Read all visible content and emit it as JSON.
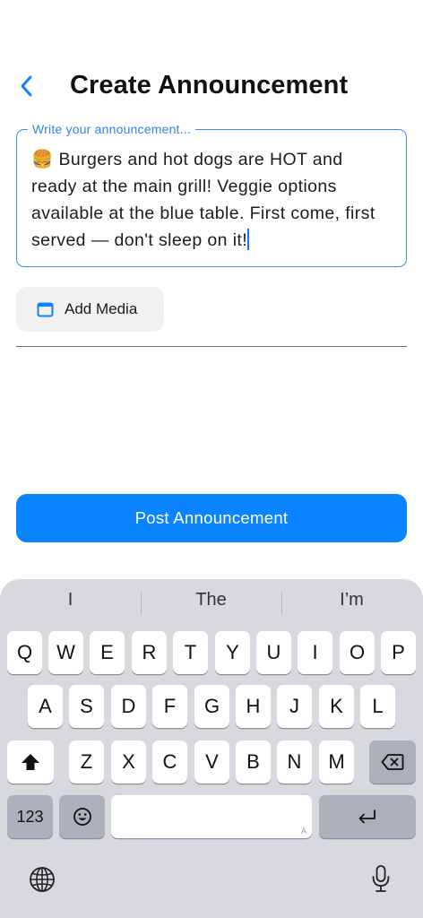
{
  "header": {
    "title": "Create Announcement"
  },
  "composer": {
    "label": "Write your announcement...",
    "text": "🍔 Burgers and hot dogs are HOT and ready at the main grill! Veggie options available at the blue table. First come, first served — don't sleep on it!"
  },
  "media": {
    "label": "Add Media"
  },
  "post": {
    "label": "Post Announcement"
  },
  "keyboard": {
    "suggestions": [
      "I",
      "The",
      "I’m"
    ],
    "row1": [
      "Q",
      "W",
      "E",
      "R",
      "T",
      "Y",
      "U",
      "I",
      "O",
      "P"
    ],
    "row2": [
      "A",
      "S",
      "D",
      "F",
      "G",
      "H",
      "J",
      "K",
      "L"
    ],
    "row3": [
      "Z",
      "X",
      "C",
      "V",
      "B",
      "N",
      "M"
    ],
    "numbers_label": "123",
    "space_hint": "A",
    "icons": {
      "shift": "shift-icon",
      "delete": "delete-icon",
      "emoji": "emoji-icon",
      "return": "return-icon",
      "globe": "globe-icon",
      "mic": "microphone-icon"
    }
  },
  "colors": {
    "accent": "#0a84ff",
    "outline": "#3a8ff0",
    "keyboard_bg": "#d7d9de"
  }
}
